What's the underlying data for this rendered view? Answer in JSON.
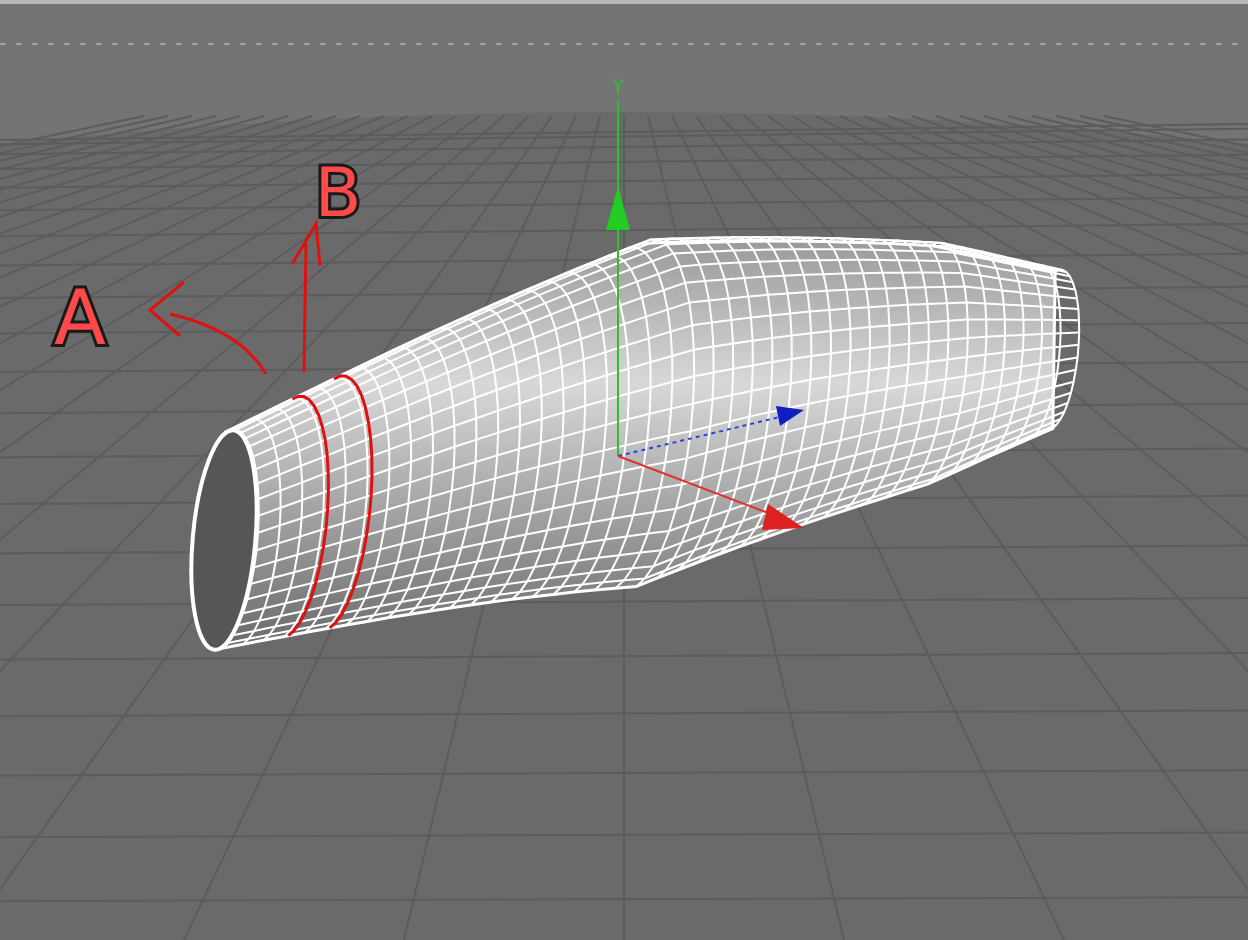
{
  "viewport": {
    "axis_label": "Y",
    "annotations": [
      {
        "label": "A"
      },
      {
        "label": "B"
      }
    ]
  }
}
